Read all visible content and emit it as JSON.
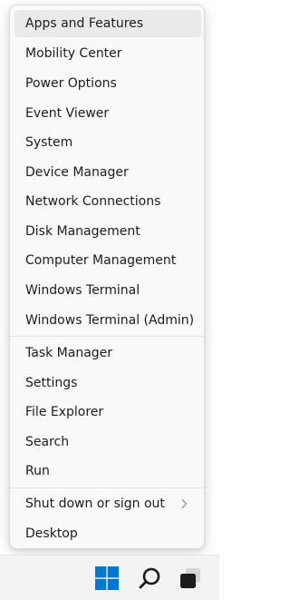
{
  "context_menu": {
    "group1": [
      "Apps and Features",
      "Mobility Center",
      "Power Options",
      "Event Viewer",
      "System",
      "Device Manager",
      "Network Connections",
      "Disk Management",
      "Computer Management",
      "Windows Terminal",
      "Windows Terminal (Admin)"
    ],
    "group2": [
      "Task Manager",
      "Settings",
      "File Explorer",
      "Search",
      "Run"
    ],
    "group3": [
      "Shut down or sign out",
      "Desktop"
    ],
    "highlighted_item": "Apps and Features",
    "submenu_item": "Shut down or sign out"
  },
  "taskbar": {
    "icons": [
      "windows-start-icon",
      "search-icon",
      "task-view-icon"
    ],
    "accent_color": "#0078d4"
  }
}
